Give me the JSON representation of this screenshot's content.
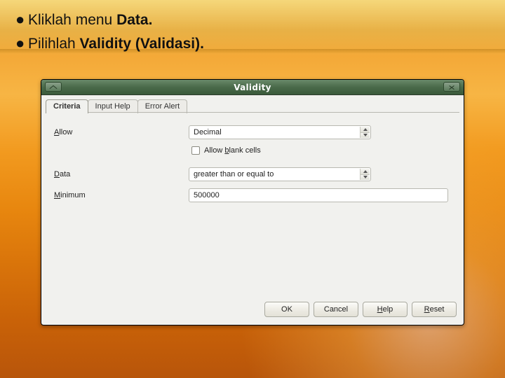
{
  "instructions": {
    "bullet_glyph": "●",
    "line1_pre": "Kliklah menu ",
    "line1_bold": "Data.",
    "line2_pre": "Pilihlah ",
    "line2_bold": "Validity (Validasi)."
  },
  "dialog": {
    "title": "Validity",
    "tabs": {
      "criteria": "Criteria",
      "input_help": "Input Help",
      "error_alert": "Error Alert"
    },
    "form": {
      "allow_label_u": "A",
      "allow_label_rest": "llow",
      "allow_value": "Decimal",
      "blank_cells_pre": "Allow ",
      "blank_cells_u": "b",
      "blank_cells_rest": "lank cells",
      "data_label_u": "D",
      "data_label_rest": "ata",
      "data_value": "greater than or equal to",
      "minimum_label_u": "M",
      "minimum_label_rest": "inimum",
      "minimum_value": "500000"
    },
    "buttons": {
      "ok": "OK",
      "cancel": "Cancel",
      "help_u": "H",
      "help_rest": "elp",
      "reset_u": "R",
      "reset_rest": "eset"
    }
  }
}
